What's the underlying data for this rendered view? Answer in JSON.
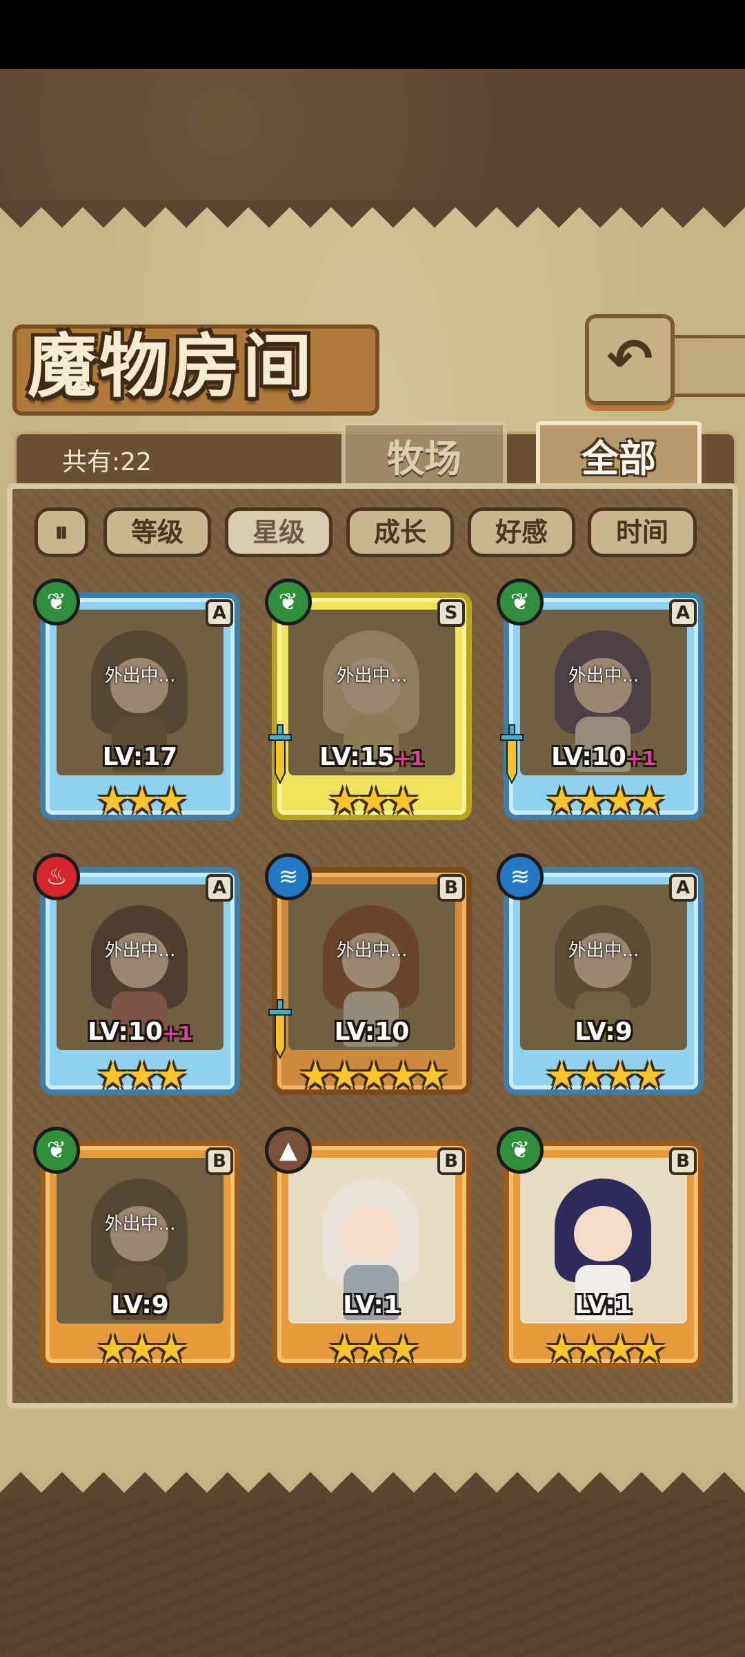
{
  "screen": {
    "title": "魔物房间",
    "back_icon": "back-arrow-icon",
    "count_label": "共有:22",
    "tabs": [
      {
        "label": "牧场",
        "active": false
      },
      {
        "label": "全部",
        "active": true
      }
    ],
    "sort_toggle_icon": "sort-toggle-icon",
    "sort_buttons": [
      {
        "label": "等级",
        "active": false
      },
      {
        "label": "星级",
        "active": true
      },
      {
        "label": "成长",
        "active": false
      },
      {
        "label": "好感",
        "active": false
      },
      {
        "label": "时间",
        "active": false
      }
    ]
  },
  "monsters": [
    {
      "element": "grass",
      "rank": "A",
      "frame": "blue",
      "status": "外出中...",
      "level": "LV:17",
      "bonus": "",
      "stars": "★★★",
      "equipped": false
    },
    {
      "element": "grass",
      "rank": "S",
      "frame": "gold",
      "status": "外出中...",
      "level": "LV:15",
      "bonus": "+1",
      "stars": "★★★",
      "equipped": true
    },
    {
      "element": "grass",
      "rank": "A",
      "frame": "blue",
      "status": "外出中...",
      "level": "LV:10",
      "bonus": "+1",
      "stars": "★★★★",
      "equipped": true
    },
    {
      "element": "fire",
      "rank": "A",
      "frame": "blue",
      "status": "外出中...",
      "level": "LV:10",
      "bonus": "+1",
      "stars": "★★★",
      "equipped": false
    },
    {
      "element": "water",
      "rank": "B",
      "frame": "bronze",
      "status": "外出中...",
      "level": "LV:10",
      "bonus": "",
      "stars": "★★★★★",
      "equipped": true
    },
    {
      "element": "water",
      "rank": "A",
      "frame": "blue",
      "status": "外出中...",
      "level": "LV:9",
      "bonus": "",
      "stars": "★★★★",
      "equipped": false
    },
    {
      "element": "grass",
      "rank": "B",
      "frame": "orange",
      "status": "外出中...",
      "level": "LV:9",
      "bonus": "",
      "stars": "★★★",
      "equipped": false
    },
    {
      "element": "earth",
      "rank": "B",
      "frame": "orange",
      "status": "",
      "level": "LV:1",
      "bonus": "",
      "stars": "★★★",
      "equipped": false
    },
    {
      "element": "grass",
      "rank": "B",
      "frame": "orange",
      "status": "",
      "level": "LV:1",
      "bonus": "",
      "stars": "★★★★",
      "equipped": false
    }
  ],
  "element_glyphs": {
    "grass": "❦",
    "fire": "♨",
    "water": "≋",
    "earth": "▲"
  },
  "colors": {
    "star": "#f9c52a",
    "bonus": "#e2409a",
    "frame_blue": "#8fd1ee",
    "frame_gold": "#f0e25a",
    "frame_orange": "#e79a3a"
  }
}
